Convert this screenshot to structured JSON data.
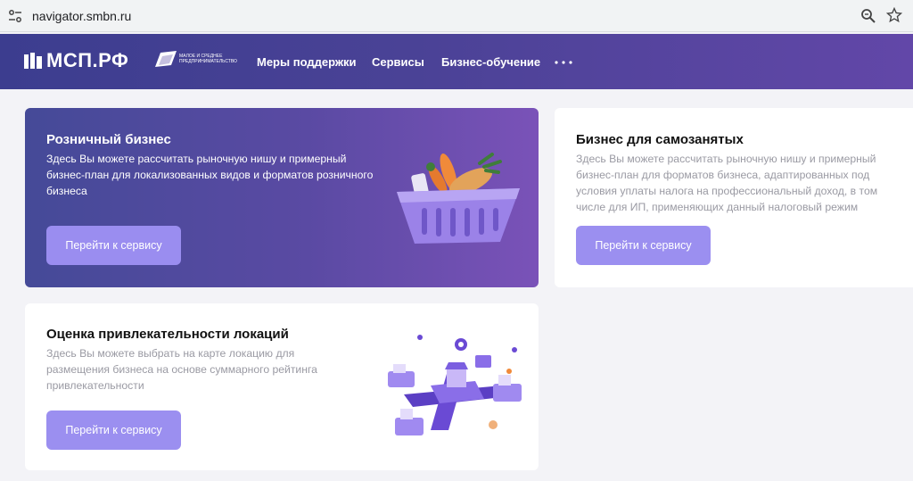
{
  "browser": {
    "url": "navigator.smbn.ru",
    "icons": [
      "tune-icon",
      "zoom-icon",
      "star-icon"
    ]
  },
  "header": {
    "logo_text": "МСП.РФ",
    "sub_logo_text": "МАЛОЕ И СРЕДНЕЕ ПРЕДПРИНИМАТЕЛЬСТВО",
    "nav": [
      "Меры поддержки",
      "Сервисы",
      "Бизнес-обучение"
    ],
    "more_icon": "more-horiz-icon"
  },
  "cards": [
    {
      "title": "Розничный бизнес",
      "description": "Здесь Вы можете рассчитать рыночную нишу и примерный бизнес-план для локализованных видов и форматов розничного бизнеса",
      "button": "Перейти к сервису",
      "illustration": "basket-icon"
    },
    {
      "title": "Бизнес для самозанятых",
      "description": "Здесь Вы можете рассчитать рыночную нишу и примерный бизнес-план для форматов бизнеса, адаптированных под условия уплаты налога на профессиональный доход, в том числе для ИП, применяющих данный налоговый режим",
      "button": "Перейти к сервису"
    },
    {
      "title": "Оценка привлекательности локаций",
      "description": "Здесь Вы можете выбрать на карте локацию для размещения бизнеса на основе суммарного рейтинга привлекательности",
      "button": "Перейти к сервису",
      "illustration": "location-map-icon"
    }
  ],
  "colors": {
    "header_gradient": [
      "#3c3d8f",
      "#6247a8"
    ],
    "button": "#9b8ff0",
    "card_accent": "#5a4aa3"
  }
}
